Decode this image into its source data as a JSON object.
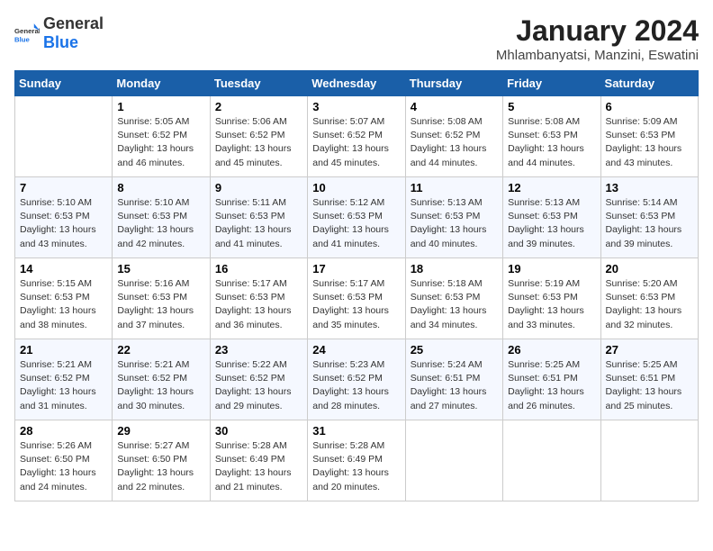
{
  "header": {
    "logo_general": "General",
    "logo_blue": "Blue",
    "title": "January 2024",
    "subtitle": "Mhlambanyatsi, Manzini, Eswatini"
  },
  "days_of_week": [
    "Sunday",
    "Monday",
    "Tuesday",
    "Wednesday",
    "Thursday",
    "Friday",
    "Saturday"
  ],
  "weeks": [
    {
      "days": [
        {
          "num": "",
          "info": ""
        },
        {
          "num": "1",
          "info": "Sunrise: 5:05 AM\nSunset: 6:52 PM\nDaylight: 13 hours\nand 46 minutes."
        },
        {
          "num": "2",
          "info": "Sunrise: 5:06 AM\nSunset: 6:52 PM\nDaylight: 13 hours\nand 45 minutes."
        },
        {
          "num": "3",
          "info": "Sunrise: 5:07 AM\nSunset: 6:52 PM\nDaylight: 13 hours\nand 45 minutes."
        },
        {
          "num": "4",
          "info": "Sunrise: 5:08 AM\nSunset: 6:52 PM\nDaylight: 13 hours\nand 44 minutes."
        },
        {
          "num": "5",
          "info": "Sunrise: 5:08 AM\nSunset: 6:53 PM\nDaylight: 13 hours\nand 44 minutes."
        },
        {
          "num": "6",
          "info": "Sunrise: 5:09 AM\nSunset: 6:53 PM\nDaylight: 13 hours\nand 43 minutes."
        }
      ]
    },
    {
      "days": [
        {
          "num": "7",
          "info": "Sunrise: 5:10 AM\nSunset: 6:53 PM\nDaylight: 13 hours\nand 43 minutes."
        },
        {
          "num": "8",
          "info": "Sunrise: 5:10 AM\nSunset: 6:53 PM\nDaylight: 13 hours\nand 42 minutes."
        },
        {
          "num": "9",
          "info": "Sunrise: 5:11 AM\nSunset: 6:53 PM\nDaylight: 13 hours\nand 41 minutes."
        },
        {
          "num": "10",
          "info": "Sunrise: 5:12 AM\nSunset: 6:53 PM\nDaylight: 13 hours\nand 41 minutes."
        },
        {
          "num": "11",
          "info": "Sunrise: 5:13 AM\nSunset: 6:53 PM\nDaylight: 13 hours\nand 40 minutes."
        },
        {
          "num": "12",
          "info": "Sunrise: 5:13 AM\nSunset: 6:53 PM\nDaylight: 13 hours\nand 39 minutes."
        },
        {
          "num": "13",
          "info": "Sunrise: 5:14 AM\nSunset: 6:53 PM\nDaylight: 13 hours\nand 39 minutes."
        }
      ]
    },
    {
      "days": [
        {
          "num": "14",
          "info": "Sunrise: 5:15 AM\nSunset: 6:53 PM\nDaylight: 13 hours\nand 38 minutes."
        },
        {
          "num": "15",
          "info": "Sunrise: 5:16 AM\nSunset: 6:53 PM\nDaylight: 13 hours\nand 37 minutes."
        },
        {
          "num": "16",
          "info": "Sunrise: 5:17 AM\nSunset: 6:53 PM\nDaylight: 13 hours\nand 36 minutes."
        },
        {
          "num": "17",
          "info": "Sunrise: 5:17 AM\nSunset: 6:53 PM\nDaylight: 13 hours\nand 35 minutes."
        },
        {
          "num": "18",
          "info": "Sunrise: 5:18 AM\nSunset: 6:53 PM\nDaylight: 13 hours\nand 34 minutes."
        },
        {
          "num": "19",
          "info": "Sunrise: 5:19 AM\nSunset: 6:53 PM\nDaylight: 13 hours\nand 33 minutes."
        },
        {
          "num": "20",
          "info": "Sunrise: 5:20 AM\nSunset: 6:53 PM\nDaylight: 13 hours\nand 32 minutes."
        }
      ]
    },
    {
      "days": [
        {
          "num": "21",
          "info": "Sunrise: 5:21 AM\nSunset: 6:52 PM\nDaylight: 13 hours\nand 31 minutes."
        },
        {
          "num": "22",
          "info": "Sunrise: 5:21 AM\nSunset: 6:52 PM\nDaylight: 13 hours\nand 30 minutes."
        },
        {
          "num": "23",
          "info": "Sunrise: 5:22 AM\nSunset: 6:52 PM\nDaylight: 13 hours\nand 29 minutes."
        },
        {
          "num": "24",
          "info": "Sunrise: 5:23 AM\nSunset: 6:52 PM\nDaylight: 13 hours\nand 28 minutes."
        },
        {
          "num": "25",
          "info": "Sunrise: 5:24 AM\nSunset: 6:51 PM\nDaylight: 13 hours\nand 27 minutes."
        },
        {
          "num": "26",
          "info": "Sunrise: 5:25 AM\nSunset: 6:51 PM\nDaylight: 13 hours\nand 26 minutes."
        },
        {
          "num": "27",
          "info": "Sunrise: 5:25 AM\nSunset: 6:51 PM\nDaylight: 13 hours\nand 25 minutes."
        }
      ]
    },
    {
      "days": [
        {
          "num": "28",
          "info": "Sunrise: 5:26 AM\nSunset: 6:50 PM\nDaylight: 13 hours\nand 24 minutes."
        },
        {
          "num": "29",
          "info": "Sunrise: 5:27 AM\nSunset: 6:50 PM\nDaylight: 13 hours\nand 22 minutes."
        },
        {
          "num": "30",
          "info": "Sunrise: 5:28 AM\nSunset: 6:49 PM\nDaylight: 13 hours\nand 21 minutes."
        },
        {
          "num": "31",
          "info": "Sunrise: 5:28 AM\nSunset: 6:49 PM\nDaylight: 13 hours\nand 20 minutes."
        },
        {
          "num": "",
          "info": ""
        },
        {
          "num": "",
          "info": ""
        },
        {
          "num": "",
          "info": ""
        }
      ]
    }
  ]
}
